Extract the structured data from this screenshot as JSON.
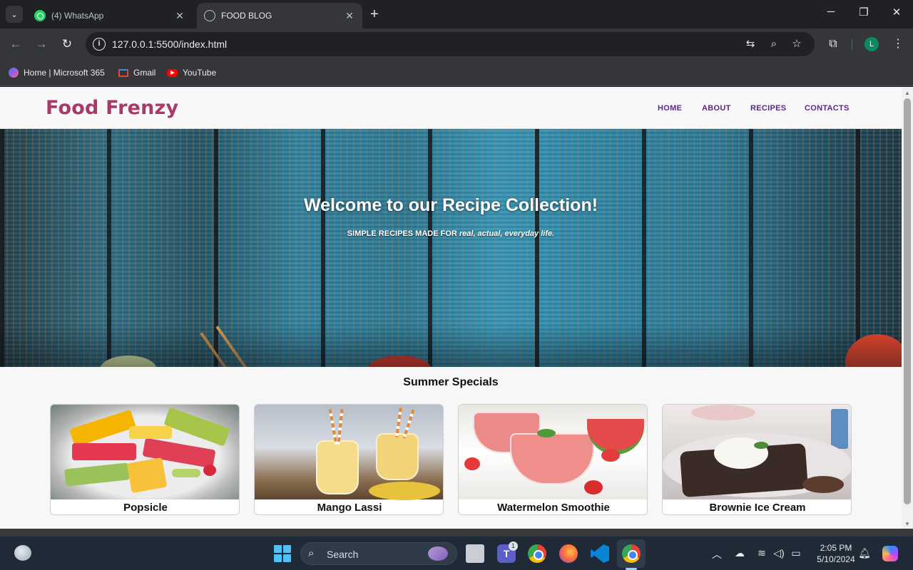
{
  "browser": {
    "tabs": [
      {
        "title": "(4) WhatsApp",
        "active": false
      },
      {
        "title": "FOOD BLOG",
        "active": true
      }
    ],
    "url": "127.0.0.1:5500/index.html",
    "profile_initial": "L",
    "bookmarks": [
      "Home | Microsoft 365",
      "Gmail",
      "YouTube"
    ]
  },
  "site": {
    "logo": "Food Frenzy",
    "nav": [
      "HOME",
      "ABOUT",
      "RECIPES",
      "CONTACTS"
    ],
    "hero": {
      "title": "Welcome to our Recipe Collection!",
      "subtitle_prefix": "SIMPLE RECIPES MADE FOR ",
      "subtitle_emphasis": "real, actual, everyday life."
    },
    "section_title": "Summer Specials",
    "cards": [
      {
        "name": "Popsicle"
      },
      {
        "name": "Mango Lassi"
      },
      {
        "name": "Watermelon Smoothie"
      },
      {
        "name": "Brownie Ice Cream"
      }
    ],
    "colors": {
      "logo": "#a83a6b",
      "nav": "#5a2a84"
    }
  },
  "taskbar": {
    "search_label": "Search",
    "teams_badge": "1",
    "time": "2:05 PM",
    "date": "5/10/2024"
  }
}
